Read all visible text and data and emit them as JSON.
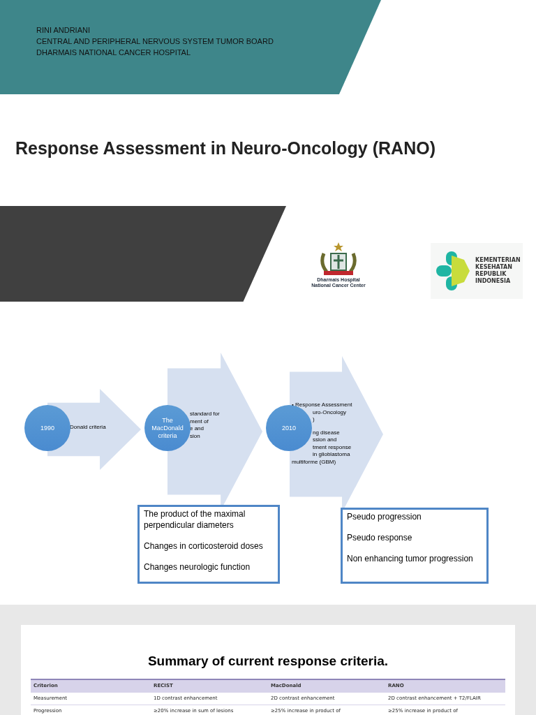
{
  "header": {
    "lines": [
      "RINI ANDRIANI",
      "CENTRAL AND PERIPHERAL NERVOUS SYSTEM TUMOR BOARD",
      "DHARMAIS NATIONAL CANCER HOSPITAL"
    ]
  },
  "title": "Response Assessment in Neuro-Oncology (RANO)",
  "logos": [
    {
      "kind": "hospital",
      "lines": [
        "Dharmais Hospital",
        "National Cancer Center"
      ]
    },
    {
      "kind": "ministry",
      "lines": [
        "KEMENTERIAN",
        "KESEHATAN",
        "REPUBLIK",
        "INDONESIA"
      ]
    }
  ],
  "timeline": [
    {
      "circle": "1990",
      "groups": [
        [
          "Donald criteria"
        ]
      ]
    },
    {
      "circle": "The MacDonald criteria",
      "groups": [
        [
          "standard for",
          "ment of",
          "e and",
          "sion"
        ]
      ]
    },
    {
      "circle": "2010",
      "groups": [
        [
          "• Response Assessment",
          "uro-Oncology",
          ")"
        ],
        [
          "ng disease",
          "ssion and",
          "tment response",
          "in glioblastoma",
          "multiforme (GBM)"
        ]
      ]
    }
  ],
  "boxes": [
    {
      "items": [
        "The product of the maximal perpendicular diameters",
        "Changes  in corticosteroid doses",
        "Changes neurologic function"
      ]
    },
    {
      "items": [
        "Pseudo progression",
        "Pseudo response",
        "Non enhancing tumor progression"
      ]
    }
  ],
  "summary": {
    "title": "Summary of current response criteria.",
    "columns": [
      "Criterion",
      "RECIST",
      "MacDonald",
      "RANO"
    ],
    "rows": [
      [
        "Measurement",
        "1D contrast enhancement",
        "2D contrast enhancement",
        "2D contrast enhancement + T2/FLAIR"
      ],
      [
        "Progression",
        "≥20% increase in sum of lesions",
        "≥25% increase in product of",
        "≥25% increase in product of"
      ]
    ]
  }
}
